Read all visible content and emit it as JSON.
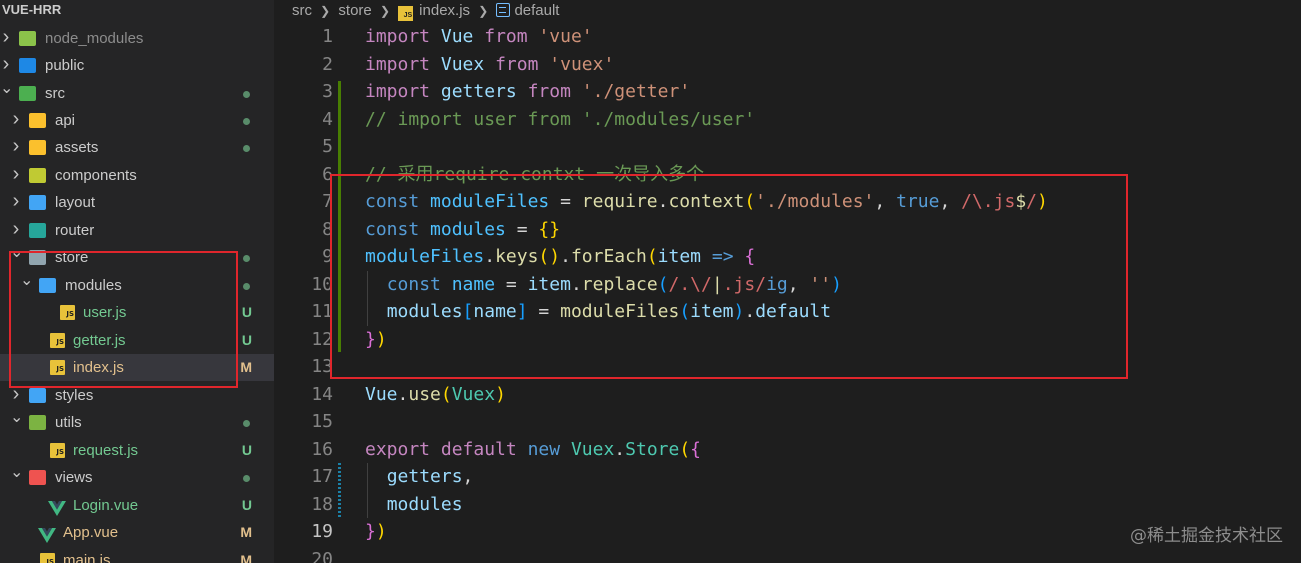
{
  "explorer": {
    "root_title": "VUE-HRR",
    "items": [
      {
        "label": "node_modules",
        "type": "folder",
        "icon": "node-modules-folder-icon",
        "expanded": false,
        "status": ""
      },
      {
        "label": "public",
        "type": "folder",
        "icon": "public-folder-icon",
        "expanded": false,
        "status": ""
      },
      {
        "label": "src",
        "type": "folder",
        "icon": "src-folder-icon",
        "expanded": true,
        "status": "dot"
      },
      {
        "label": "api",
        "type": "folder",
        "icon": "api-folder-icon",
        "expanded": false,
        "status": "dot"
      },
      {
        "label": "assets",
        "type": "folder",
        "icon": "assets-folder-icon",
        "expanded": false,
        "status": "dot"
      },
      {
        "label": "components",
        "type": "folder",
        "icon": "components-folder-icon",
        "expanded": false,
        "status": ""
      },
      {
        "label": "layout",
        "type": "folder",
        "icon": "layout-folder-icon",
        "expanded": false,
        "status": ""
      },
      {
        "label": "router",
        "type": "folder",
        "icon": "router-folder-icon",
        "expanded": false,
        "status": ""
      },
      {
        "label": "store",
        "type": "folder",
        "icon": "store-folder-icon",
        "expanded": true,
        "status": "dot"
      },
      {
        "label": "modules",
        "type": "folder",
        "icon": "modules-folder-icon",
        "expanded": true,
        "status": "dot"
      },
      {
        "label": "user.js",
        "type": "js",
        "icon": "js-file-icon",
        "status": "U"
      },
      {
        "label": "getter.js",
        "type": "js",
        "icon": "js-file-icon",
        "status": "U"
      },
      {
        "label": "index.js",
        "type": "js",
        "icon": "js-file-icon",
        "status": "M",
        "selected": true
      },
      {
        "label": "styles",
        "type": "folder",
        "icon": "styles-folder-icon",
        "expanded": false,
        "status": ""
      },
      {
        "label": "utils",
        "type": "folder",
        "icon": "utils-folder-icon",
        "expanded": true,
        "status": "dot"
      },
      {
        "label": "request.js",
        "type": "js",
        "icon": "js-file-icon",
        "status": "U"
      },
      {
        "label": "views",
        "type": "folder",
        "icon": "views-folder-icon",
        "expanded": true,
        "status": "dot"
      },
      {
        "label": "Login.vue",
        "type": "vue",
        "icon": "vue-file-icon",
        "status": "U"
      },
      {
        "label": "App.vue",
        "type": "vue",
        "icon": "vue-file-icon",
        "status": "M"
      },
      {
        "label": "main.js",
        "type": "js",
        "icon": "js-file-icon",
        "status": "M"
      }
    ]
  },
  "breadcrumb": {
    "parts": [
      "src",
      "store",
      "index.js",
      "default"
    ],
    "file_icon": "js-file-icon",
    "symbol_icon": "symbol-field-icon",
    "separator_icon": "chevron-right-icon"
  },
  "editor": {
    "current_line": 19,
    "lines": [
      {
        "n": "1",
        "tokens": [
          [
            "kw2",
            "import"
          ],
          [
            "pl",
            " "
          ],
          [
            "id",
            "Vue"
          ],
          [
            "pl",
            " "
          ],
          [
            "kw2",
            "from"
          ],
          [
            "pl",
            " "
          ],
          [
            "str",
            "'vue'"
          ]
        ]
      },
      {
        "n": "2",
        "tokens": [
          [
            "kw2",
            "import"
          ],
          [
            "pl",
            " "
          ],
          [
            "id",
            "Vuex"
          ],
          [
            "pl",
            " "
          ],
          [
            "kw2",
            "from"
          ],
          [
            "pl",
            " "
          ],
          [
            "str",
            "'vuex'"
          ]
        ]
      },
      {
        "n": "3",
        "tokens": [
          [
            "kw2",
            "import"
          ],
          [
            "pl",
            " "
          ],
          [
            "id",
            "getters"
          ],
          [
            "pl",
            " "
          ],
          [
            "kw2",
            "from"
          ],
          [
            "pl",
            " "
          ],
          [
            "str",
            "'./getter'"
          ]
        ]
      },
      {
        "n": "4",
        "tokens": [
          [
            "cmt",
            "// import user from './modules/user'"
          ]
        ]
      },
      {
        "n": "5",
        "tokens": []
      },
      {
        "n": "6",
        "tokens": [
          [
            "cmt",
            "// 采用require.contxt 一次导入多个"
          ]
        ]
      },
      {
        "n": "7",
        "tokens": [
          [
            "kw",
            "const"
          ],
          [
            "pl",
            " "
          ],
          [
            "con",
            "moduleFiles"
          ],
          [
            "pl",
            " = "
          ],
          [
            "fn",
            "require"
          ],
          [
            "pl",
            "."
          ],
          [
            "fn",
            "context"
          ],
          [
            "br1",
            "("
          ],
          [
            "str",
            "'./modules'"
          ],
          [
            "pl",
            ", "
          ],
          [
            "kw",
            "true"
          ],
          [
            "pl",
            ", "
          ],
          [
            "rx",
            "/\\."
          ],
          [
            "rx",
            "js"
          ],
          [
            "rxe",
            "$"
          ],
          [
            "rx",
            "/"
          ],
          [
            "br1",
            ")"
          ]
        ]
      },
      {
        "n": "8",
        "tokens": [
          [
            "kw",
            "const"
          ],
          [
            "pl",
            " "
          ],
          [
            "con",
            "modules"
          ],
          [
            "pl",
            " = "
          ],
          [
            "br1",
            "{}"
          ]
        ]
      },
      {
        "n": "9",
        "tokens": [
          [
            "con",
            "moduleFiles"
          ],
          [
            "pl",
            "."
          ],
          [
            "fn",
            "keys"
          ],
          [
            "br1",
            "()"
          ],
          [
            "pl",
            "."
          ],
          [
            "fn",
            "forEach"
          ],
          [
            "br1",
            "("
          ],
          [
            "id",
            "item"
          ],
          [
            "pl",
            " "
          ],
          [
            "kw",
            "=>"
          ],
          [
            "pl",
            " "
          ],
          [
            "br2",
            "{"
          ]
        ]
      },
      {
        "n": "10",
        "tokens": [
          [
            "pl",
            "  "
          ],
          [
            "kw",
            "const"
          ],
          [
            "pl",
            " "
          ],
          [
            "con",
            "name"
          ],
          [
            "pl",
            " = "
          ],
          [
            "id",
            "item"
          ],
          [
            "pl",
            "."
          ],
          [
            "fn",
            "replace"
          ],
          [
            "br3",
            "("
          ],
          [
            "rx",
            "/.\\/"
          ],
          [
            "rxe",
            "|"
          ],
          [
            "rx",
            ".js/"
          ],
          [
            "kw",
            "ig"
          ],
          [
            "pl",
            ", "
          ],
          [
            "str",
            "''"
          ],
          [
            "br3",
            ")"
          ]
        ]
      },
      {
        "n": "11",
        "tokens": [
          [
            "pl",
            "  "
          ],
          [
            "id",
            "modules"
          ],
          [
            "br3",
            "["
          ],
          [
            "id",
            "name"
          ],
          [
            "br3",
            "]"
          ],
          [
            "pl",
            " = "
          ],
          [
            "fn",
            "moduleFiles"
          ],
          [
            "br3",
            "("
          ],
          [
            "id",
            "item"
          ],
          [
            "br3",
            ")"
          ],
          [
            "pl",
            "."
          ],
          [
            "id",
            "default"
          ]
        ]
      },
      {
        "n": "12",
        "tokens": [
          [
            "br2",
            "}"
          ],
          [
            "br1",
            ")"
          ]
        ]
      },
      {
        "n": "13",
        "tokens": []
      },
      {
        "n": "14",
        "tokens": [
          [
            "id",
            "Vue"
          ],
          [
            "pl",
            "."
          ],
          [
            "fn",
            "use"
          ],
          [
            "br1",
            "("
          ],
          [
            "cls",
            "Vuex"
          ],
          [
            "br1",
            ")"
          ]
        ]
      },
      {
        "n": "15",
        "tokens": []
      },
      {
        "n": "16",
        "tokens": [
          [
            "kw2",
            "export"
          ],
          [
            "pl",
            " "
          ],
          [
            "kw2",
            "default"
          ],
          [
            "pl",
            " "
          ],
          [
            "kw",
            "new"
          ],
          [
            "pl",
            " "
          ],
          [
            "cls",
            "Vuex"
          ],
          [
            "pl",
            "."
          ],
          [
            "cls",
            "Store"
          ],
          [
            "br1",
            "("
          ],
          [
            "br2",
            "{"
          ]
        ]
      },
      {
        "n": "17",
        "tokens": [
          [
            "pl",
            "  "
          ],
          [
            "id",
            "getters"
          ],
          [
            "pl",
            ","
          ]
        ]
      },
      {
        "n": "18",
        "tokens": [
          [
            "pl",
            "  "
          ],
          [
            "id",
            "modules"
          ]
        ]
      },
      {
        "n": "19",
        "tokens": [
          [
            "br2",
            "}"
          ],
          [
            "br1",
            ")"
          ]
        ]
      },
      {
        "n": "20",
        "tokens": []
      }
    ]
  },
  "watermark": "@稀土掘金技术社区",
  "colors": {
    "highlight_box": "#e0262c",
    "git_added": "#487e02",
    "git_modified": "#1b81a8",
    "status_untracked": "#73c991",
    "status_modified": "#e2c08d"
  }
}
